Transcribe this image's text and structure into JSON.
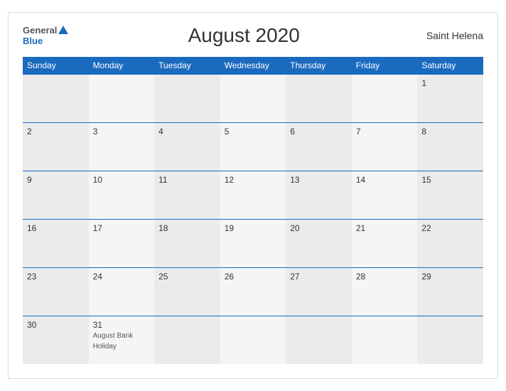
{
  "header": {
    "logo_general": "General",
    "logo_blue": "Blue",
    "title": "August 2020",
    "location": "Saint Helena"
  },
  "weekdays": [
    "Sunday",
    "Monday",
    "Tuesday",
    "Wednesday",
    "Thursday",
    "Friday",
    "Saturday"
  ],
  "weeks": [
    [
      "",
      "",
      "",
      "",
      "",
      "",
      "1"
    ],
    [
      "2",
      "3",
      "4",
      "5",
      "6",
      "7",
      "8"
    ],
    [
      "9",
      "10",
      "11",
      "12",
      "13",
      "14",
      "15"
    ],
    [
      "16",
      "17",
      "18",
      "19",
      "20",
      "21",
      "22"
    ],
    [
      "23",
      "24",
      "25",
      "26",
      "27",
      "28",
      "29"
    ],
    [
      "30",
      "31",
      "",
      "",
      "",
      "",
      ""
    ]
  ],
  "holidays": {
    "31": "August Bank Holiday"
  }
}
